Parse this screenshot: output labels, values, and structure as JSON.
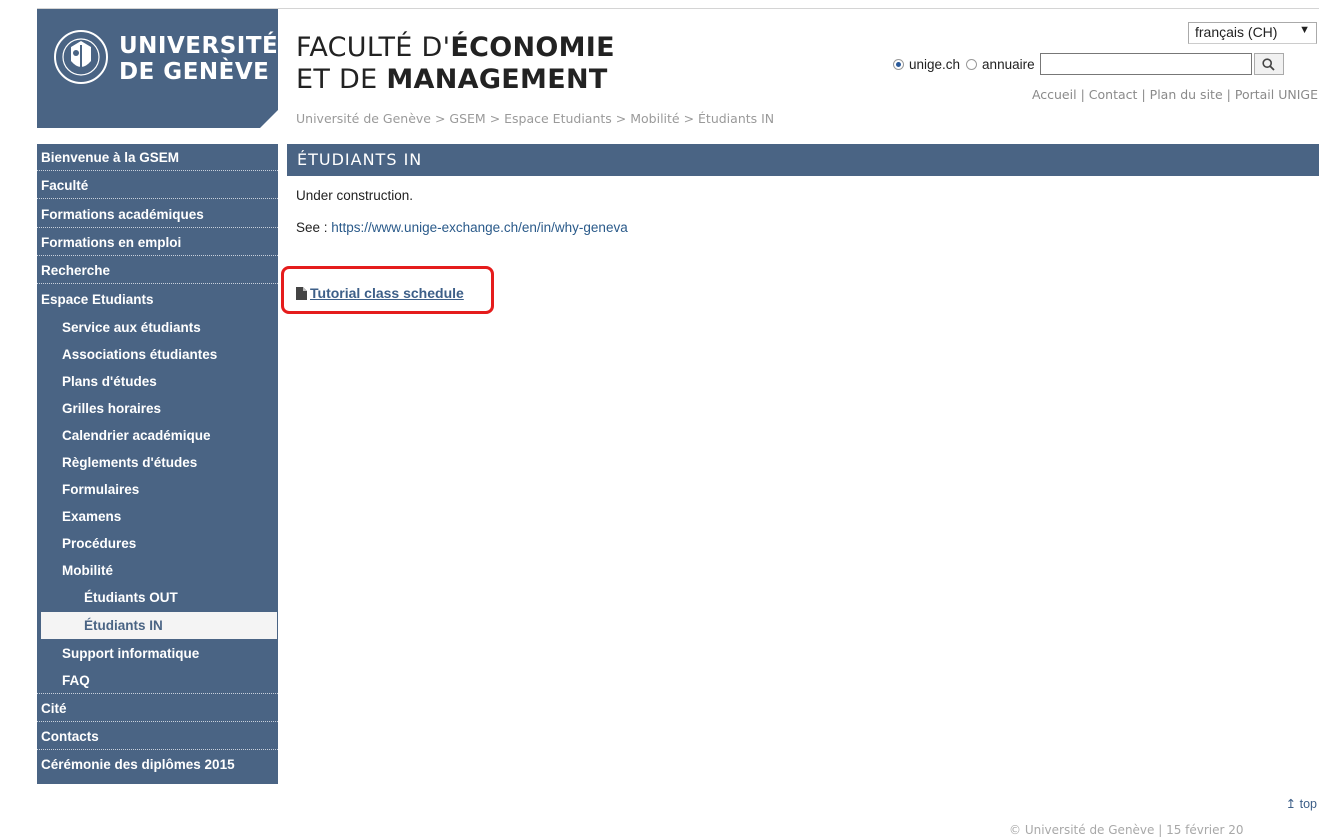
{
  "header": {
    "university_line1": "UNIVERSITÉ",
    "university_line2": "DE GENÈVE",
    "faculty_line1_prefix": "FACULTÉ D'",
    "faculty_line1_bold": "ÉCONOMIE",
    "faculty_line2_prefix": "ET DE ",
    "faculty_line2_bold": "MANAGEMENT",
    "breadcrumb": "Université de Genève > GSEM > Espace Etudiants > Mobilité > Étudiants IN"
  },
  "language_select": {
    "value": "français (CH)"
  },
  "search": {
    "option1": "unige.ch",
    "option2": "annuaire",
    "value": ""
  },
  "top_links": [
    "Accueil",
    "Contact",
    "Plan du site",
    "Portail UNIGE"
  ],
  "sidebar": {
    "items": [
      {
        "label": "Bienvenue à la GSEM"
      },
      {
        "label": "Faculté"
      },
      {
        "label": "Formations académiques"
      },
      {
        "label": "Formations en emploi"
      },
      {
        "label": "Recherche"
      },
      {
        "label": "Espace Etudiants"
      },
      {
        "label": "Service aux étudiants"
      },
      {
        "label": "Associations étudiantes"
      },
      {
        "label": "Plans d'études"
      },
      {
        "label": "Grilles horaires"
      },
      {
        "label": "Calendrier académique"
      },
      {
        "label": "Règlements d'études"
      },
      {
        "label": "Formulaires"
      },
      {
        "label": "Examens"
      },
      {
        "label": "Procédures"
      },
      {
        "label": "Mobilité"
      },
      {
        "label": "Étudiants OUT"
      },
      {
        "label": "Étudiants IN"
      },
      {
        "label": "Support informatique"
      },
      {
        "label": "FAQ"
      },
      {
        "label": "Cité"
      },
      {
        "label": "Contacts"
      },
      {
        "label": "Cérémonie des diplômes 2015"
      }
    ]
  },
  "content": {
    "title": "ÉTUDIANTS IN",
    "line1": "Under construction.",
    "see_prefix": "See : ",
    "see_link": "https://www.unige-exchange.ch/en/in/why-geneva",
    "document_link": "Tutorial class schedule"
  },
  "top_link": "top",
  "footer": "© Université de Genève | 15 février 20",
  "colors": {
    "brand": "#4a6484",
    "highlight": "#e51c1c"
  },
  "icons": [
    "search-icon",
    "document-icon",
    "arrow-up-icon",
    "chevron-down-icon",
    "university-seal-icon"
  ]
}
